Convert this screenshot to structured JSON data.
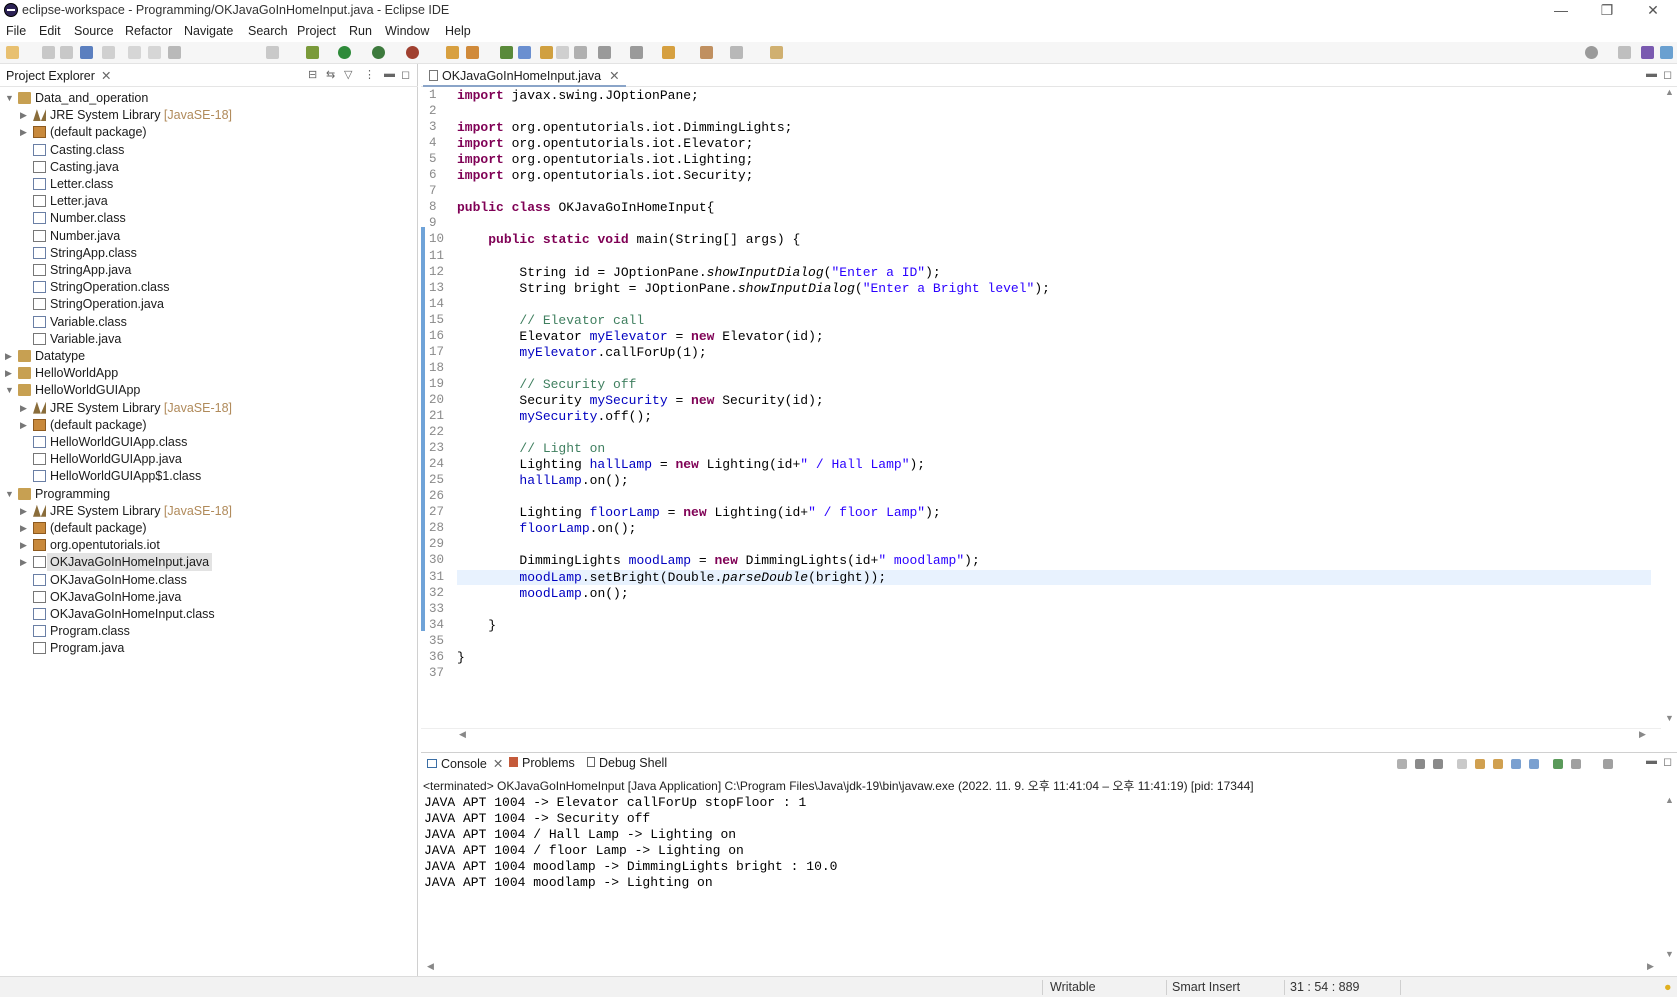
{
  "window": {
    "title": "eclipse-workspace - Programming/OKJavaGoInHomeInput.java - Eclipse IDE",
    "minimize": "—",
    "restore": "❐",
    "close": "✕"
  },
  "menu": [
    "File",
    "Edit",
    "Source",
    "Refactor",
    "Navigate",
    "Search",
    "Project",
    "Run",
    "Window",
    "Help"
  ],
  "project_explorer": {
    "tab_label": "Project Explorer",
    "tree": [
      {
        "label": "Data_and_operation",
        "level": 0,
        "expanded": true,
        "icon": "project-icon"
      },
      {
        "label": "JRE System Library",
        "decoration": "[JavaSE-18]",
        "level": 1,
        "expanded": false,
        "icon": "library-icon"
      },
      {
        "label": "(default package)",
        "level": 1,
        "expanded": false,
        "icon": "package-icon"
      },
      {
        "label": "Casting.class",
        "level": 1,
        "icon": "class-file-icon"
      },
      {
        "label": "Casting.java",
        "level": 1,
        "icon": "java-file-icon"
      },
      {
        "label": "Letter.class",
        "level": 1,
        "icon": "class-file-icon"
      },
      {
        "label": "Letter.java",
        "level": 1,
        "icon": "java-file-icon"
      },
      {
        "label": "Number.class",
        "level": 1,
        "icon": "class-file-icon"
      },
      {
        "label": "Number.java",
        "level": 1,
        "icon": "java-file-icon"
      },
      {
        "label": "StringApp.class",
        "level": 1,
        "icon": "class-file-icon"
      },
      {
        "label": "StringApp.java",
        "level": 1,
        "icon": "java-file-icon"
      },
      {
        "label": "StringOperation.class",
        "level": 1,
        "icon": "class-file-icon"
      },
      {
        "label": "StringOperation.java",
        "level": 1,
        "icon": "java-file-icon"
      },
      {
        "label": "Variable.class",
        "level": 1,
        "icon": "class-file-icon"
      },
      {
        "label": "Variable.java",
        "level": 1,
        "icon": "java-file-icon"
      },
      {
        "label": "Datatype",
        "level": 0,
        "expanded": false,
        "icon": "project-icon"
      },
      {
        "label": "HelloWorldApp",
        "level": 0,
        "expanded": false,
        "icon": "project-icon"
      },
      {
        "label": "HelloWorldGUIApp",
        "level": 0,
        "expanded": true,
        "icon": "project-icon"
      },
      {
        "label": "JRE System Library",
        "decoration": "[JavaSE-18]",
        "level": 1,
        "expanded": false,
        "icon": "library-icon"
      },
      {
        "label": "(default package)",
        "level": 1,
        "expanded": false,
        "icon": "package-icon"
      },
      {
        "label": "HelloWorldGUIApp.class",
        "level": 1,
        "icon": "class-file-icon"
      },
      {
        "label": "HelloWorldGUIApp.java",
        "level": 1,
        "icon": "java-file-icon"
      },
      {
        "label": "HelloWorldGUIApp$1.class",
        "level": 1,
        "icon": "class-file-icon"
      },
      {
        "label": "Programming",
        "level": 0,
        "expanded": true,
        "icon": "project-icon"
      },
      {
        "label": "JRE System Library",
        "decoration": "[JavaSE-18]",
        "level": 1,
        "expanded": false,
        "icon": "library-icon"
      },
      {
        "label": "(default package)",
        "level": 1,
        "expanded": false,
        "icon": "package-icon"
      },
      {
        "label": "org.opentutorials.iot",
        "level": 1,
        "expanded": false,
        "icon": "package-icon"
      },
      {
        "label": "OKJavaGoInHomeInput.java",
        "level": 1,
        "expanded": false,
        "icon": "java-file-icon",
        "selected": true
      },
      {
        "label": "OKJavaGoInHome.class",
        "level": 1,
        "icon": "class-file-icon"
      },
      {
        "label": "OKJavaGoInHome.java",
        "level": 1,
        "icon": "java-file-icon"
      },
      {
        "label": "OKJavaGoInHomeInput.class",
        "level": 1,
        "icon": "class-file-icon"
      },
      {
        "label": "Program.class",
        "level": 1,
        "icon": "class-file-icon"
      },
      {
        "label": "Program.java",
        "level": 1,
        "icon": "java-file-icon"
      }
    ]
  },
  "editor": {
    "tab_label": "OKJavaGoInHomeInput.java",
    "current_line": 31,
    "lines": [
      [
        [
          "kw",
          "import"
        ],
        [
          "t",
          " javax.swing.JOptionPane;"
        ]
      ],
      [],
      [
        [
          "kw",
          "import"
        ],
        [
          "t",
          " org.opentutorials.iot.DimmingLights;"
        ]
      ],
      [
        [
          "kw",
          "import"
        ],
        [
          "t",
          " org.opentutorials.iot.Elevator;"
        ]
      ],
      [
        [
          "kw",
          "import"
        ],
        [
          "t",
          " org.opentutorials.iot.Lighting;"
        ]
      ],
      [
        [
          "kw",
          "import"
        ],
        [
          "t",
          " org.opentutorials.iot.Security;"
        ]
      ],
      [],
      [
        [
          "kw",
          "public"
        ],
        [
          "t",
          " "
        ],
        [
          "kw",
          "class"
        ],
        [
          "t",
          " OKJavaGoInHomeInput{"
        ]
      ],
      [],
      [
        [
          "t",
          "    "
        ],
        [
          "kw",
          "public"
        ],
        [
          "t",
          " "
        ],
        [
          "kw",
          "static"
        ],
        [
          "t",
          " "
        ],
        [
          "kw",
          "void"
        ],
        [
          "t",
          " main(String[] args) {"
        ]
      ],
      [],
      [
        [
          "t",
          "        String id = JOptionPane."
        ],
        [
          "it",
          "showInputDialog"
        ],
        [
          "t",
          "("
        ],
        [
          "st",
          "\"Enter a ID\""
        ],
        [
          "t",
          ");"
        ]
      ],
      [
        [
          "t",
          "        String bright = JOptionPane."
        ],
        [
          "it",
          "showInputDialog"
        ],
        [
          "t",
          "("
        ],
        [
          "st",
          "\"Enter a Bright level\""
        ],
        [
          "t",
          ");"
        ]
      ],
      [],
      [
        [
          "cm",
          "        // Elevator call"
        ]
      ],
      [
        [
          "t",
          "        Elevator "
        ],
        [
          "fd",
          "myElevator"
        ],
        [
          "t",
          " = "
        ],
        [
          "kw",
          "new"
        ],
        [
          "t",
          " Elevator(id);"
        ]
      ],
      [
        [
          "t",
          "        "
        ],
        [
          "fd",
          "myElevator"
        ],
        [
          "t",
          ".callForUp(1);"
        ]
      ],
      [],
      [
        [
          "cm",
          "        // Security off"
        ]
      ],
      [
        [
          "t",
          "        Security "
        ],
        [
          "fd",
          "mySecurity"
        ],
        [
          "t",
          " = "
        ],
        [
          "kw",
          "new"
        ],
        [
          "t",
          " Security(id);"
        ]
      ],
      [
        [
          "t",
          "        "
        ],
        [
          "fd",
          "mySecurity"
        ],
        [
          "t",
          ".off();"
        ]
      ],
      [],
      [
        [
          "cm",
          "        // Light on"
        ]
      ],
      [
        [
          "t",
          "        Lighting "
        ],
        [
          "fd",
          "hallLamp"
        ],
        [
          "t",
          " = "
        ],
        [
          "kw",
          "new"
        ],
        [
          "t",
          " Lighting(id+"
        ],
        [
          "st",
          "\" / Hall Lamp\""
        ],
        [
          "t",
          ");"
        ]
      ],
      [
        [
          "t",
          "        "
        ],
        [
          "fd",
          "hallLamp"
        ],
        [
          "t",
          ".on();"
        ]
      ],
      [],
      [
        [
          "t",
          "        Lighting "
        ],
        [
          "fd",
          "floorLamp"
        ],
        [
          "t",
          " = "
        ],
        [
          "kw",
          "new"
        ],
        [
          "t",
          " Lighting(id+"
        ],
        [
          "st",
          "\" / floor Lamp\""
        ],
        [
          "t",
          ");"
        ]
      ],
      [
        [
          "t",
          "        "
        ],
        [
          "fd",
          "floorLamp"
        ],
        [
          "t",
          ".on();"
        ]
      ],
      [],
      [
        [
          "t",
          "        DimmingLights "
        ],
        [
          "fd",
          "moodLamp"
        ],
        [
          "t",
          " = "
        ],
        [
          "kw",
          "new"
        ],
        [
          "t",
          " DimmingLights(id+"
        ],
        [
          "st",
          "\" moodlamp\""
        ],
        [
          "t",
          ");"
        ]
      ],
      [
        [
          "t",
          "        "
        ],
        [
          "fd",
          "moodLamp"
        ],
        [
          "t",
          ".setBright(Double."
        ],
        [
          "it",
          "parseDouble"
        ],
        [
          "t",
          "(bright));"
        ]
      ],
      [
        [
          "t",
          "        "
        ],
        [
          "fd",
          "moodLamp"
        ],
        [
          "t",
          ".on();"
        ]
      ],
      [],
      [
        [
          "t",
          "    }"
        ]
      ],
      [],
      [
        [
          "t",
          "}"
        ]
      ],
      []
    ]
  },
  "console": {
    "tabs": [
      {
        "label": "Console",
        "icon": "console-icon"
      },
      {
        "label": "Problems",
        "icon": "problems-icon"
      },
      {
        "label": "Debug Shell",
        "icon": "debug-shell-icon"
      }
    ],
    "info": "<terminated> OKJavaGoInHomeInput [Java Application] C:\\Program Files\\Java\\jdk-19\\bin\\javaw.exe  (2022. 11. 9. 오후 11:41:04 – 오후 11:41:19) [pid: 17344]",
    "output": [
      "JAVA APT 1004 -> Elevator callForUp stopFloor : 1",
      "JAVA APT 1004 -> Security off",
      "JAVA APT 1004 / Hall Lamp -> Lighting on",
      "JAVA APT 1004 / floor Lamp -> Lighting on",
      "JAVA APT 1004 moodlamp -> DimmingLights bright : 10.0",
      "JAVA APT 1004 moodlamp -> Lighting on"
    ]
  },
  "status": {
    "mode": "Writable",
    "insert": "Smart Insert",
    "position": "31 : 54 : 889"
  },
  "colors": {
    "keyword": "#7f0055",
    "string": "#2a00ff",
    "comment": "#3f7f5f",
    "field": "#0000c0",
    "current_line": "#e8f2fe"
  }
}
